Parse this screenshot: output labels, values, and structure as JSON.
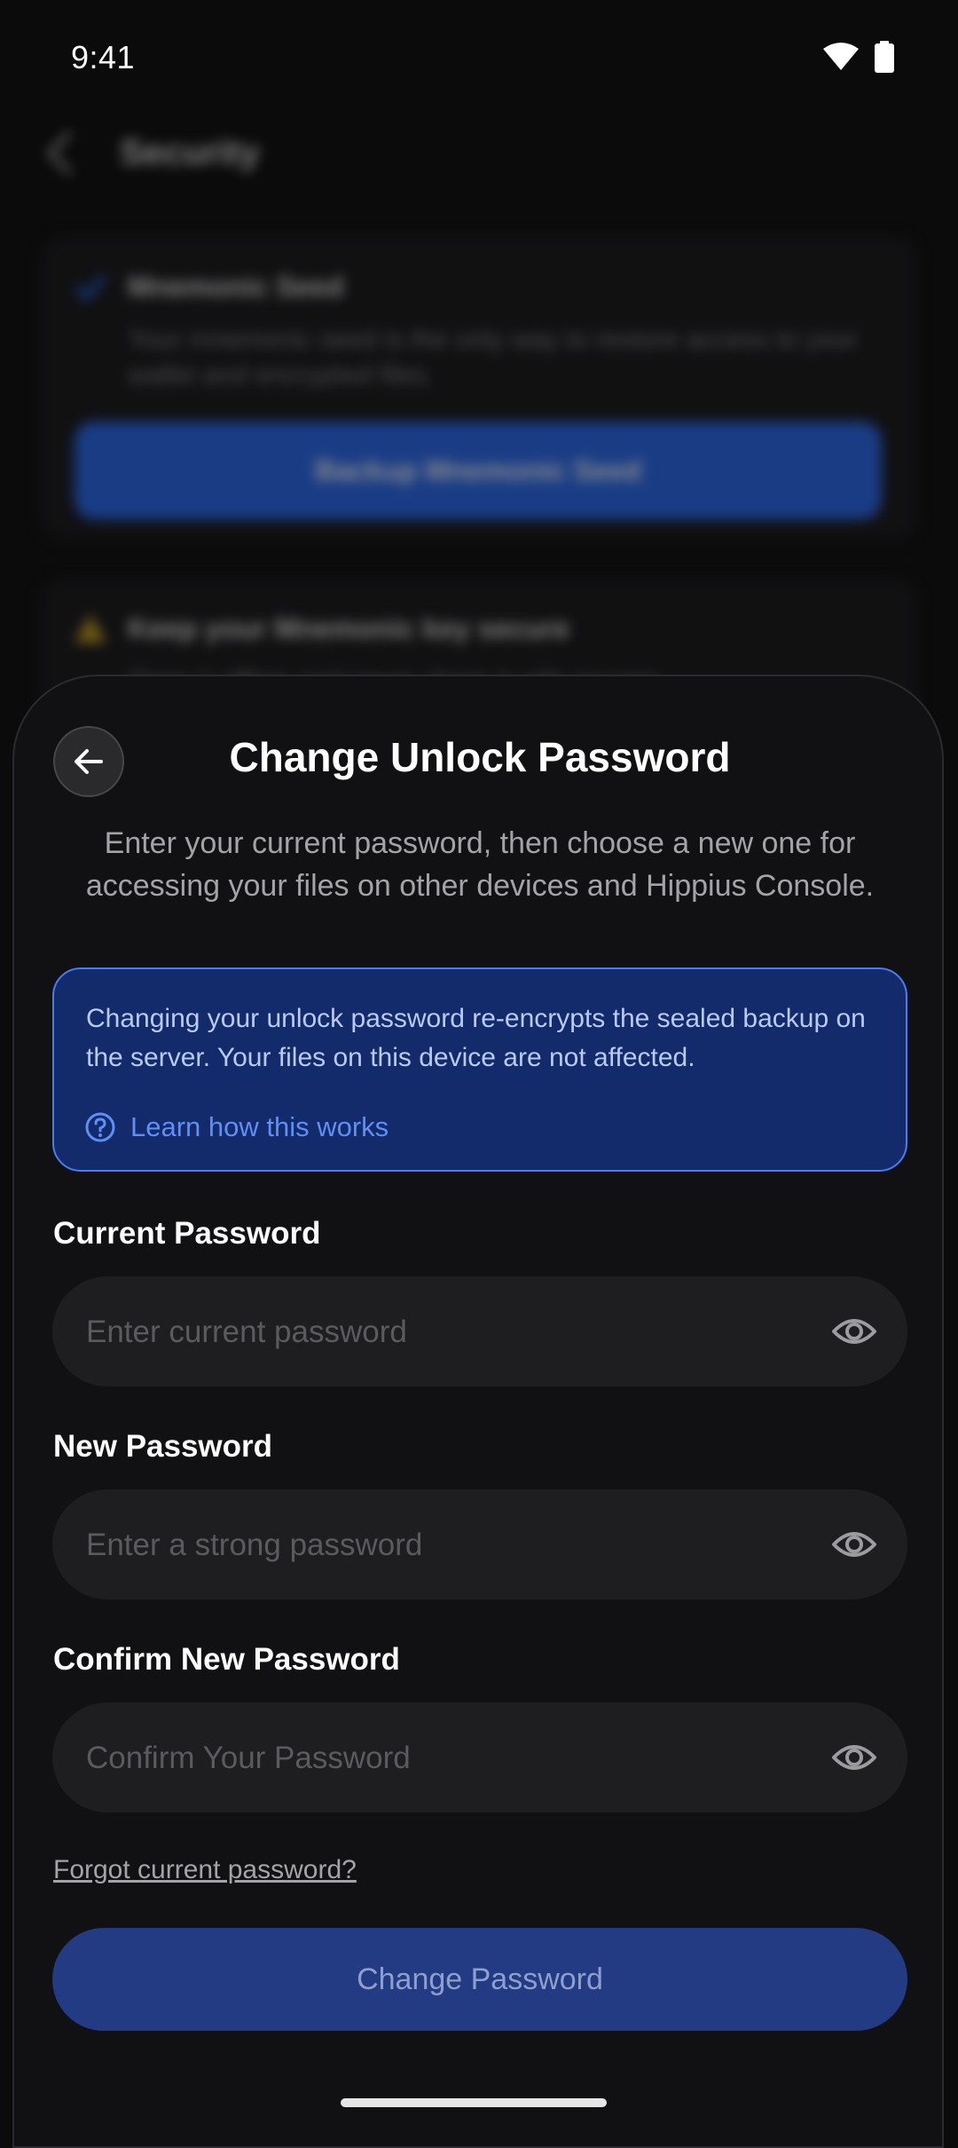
{
  "status_bar": {
    "time": "9:41",
    "icons": [
      "wifi-icon",
      "battery-icon"
    ]
  },
  "background": {
    "header_title": "Security",
    "card1": {
      "title": "Mnemonic Seed",
      "description": "Your mnemonic seed is the only way to restore access to your wallet and encrypted files.",
      "button_label": "Backup Mnemonic Seed"
    },
    "card2": {
      "title": "Keep your Mnemonic key secure",
      "description": "Store it offline and never share it with anyone."
    }
  },
  "sheet": {
    "title": "Change Unlock Password",
    "subtitle": "Enter your current password, then choose a new one for accessing your files on other devices and Hippius Console.",
    "info": {
      "text": "Changing your unlock password re-encrypts the sealed backup on the server. Your files on this device are not affected.",
      "link_label": "Learn how this works"
    },
    "fields": {
      "current": {
        "label": "Current Password",
        "placeholder": "Enter current password",
        "value": ""
      },
      "new": {
        "label": "New Password",
        "placeholder": "Enter a strong password",
        "value": ""
      },
      "confirm": {
        "label": "Confirm New Password",
        "placeholder": "Confirm Your Password",
        "value": ""
      }
    },
    "forgot_label": "Forgot current password?",
    "submit_label": "Change Password"
  },
  "colors": {
    "accent": "#2f6ef2",
    "info_background": "#132a6b",
    "info_border": "#4a7bf0",
    "link": "#5f8ef5",
    "disabled_button": "#223b82",
    "sheet_background": "#111113",
    "input_background": "#1e1e21"
  }
}
